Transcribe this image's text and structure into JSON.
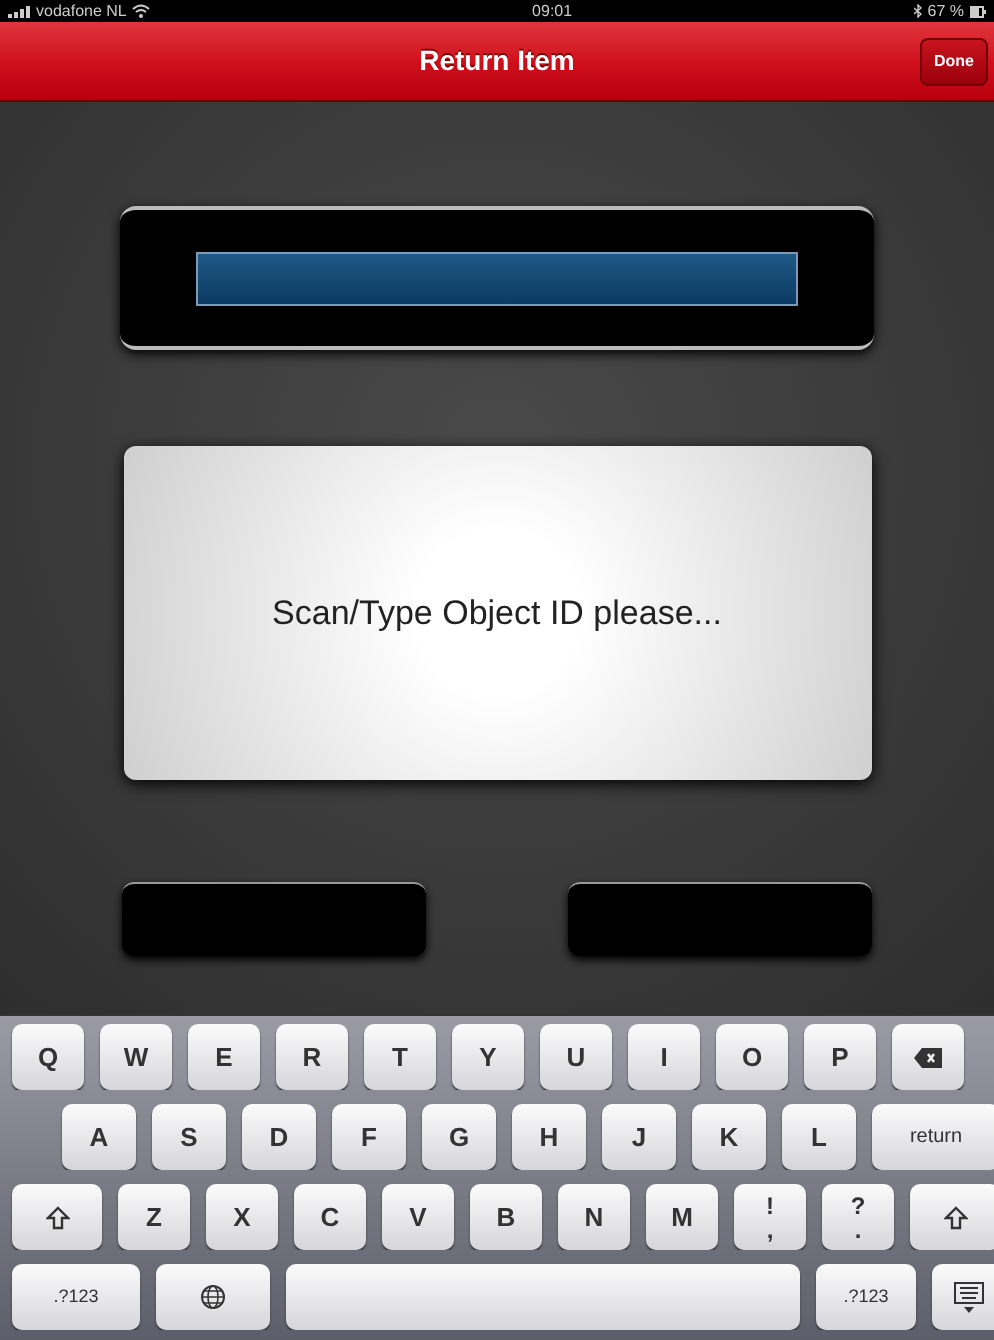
{
  "status_bar": {
    "carrier": "vodafone NL",
    "time": "09:01",
    "battery": "67 %"
  },
  "nav_bar": {
    "title": "Return Item",
    "done_button": "Done"
  },
  "message": "Scan/Type Object ID please...",
  "keyboard": {
    "rows": [
      [
        {
          "kind": "char",
          "label": "Q"
        },
        {
          "kind": "char",
          "label": "W"
        },
        {
          "kind": "char",
          "label": "E"
        },
        {
          "kind": "char",
          "label": "R"
        },
        {
          "kind": "char",
          "label": "T"
        },
        {
          "kind": "char",
          "label": "Y"
        },
        {
          "kind": "char",
          "label": "U"
        },
        {
          "kind": "char",
          "label": "I"
        },
        {
          "kind": "char",
          "label": "O"
        },
        {
          "kind": "char",
          "label": "P"
        },
        {
          "kind": "backspace"
        }
      ],
      [
        {
          "kind": "char",
          "label": "A"
        },
        {
          "kind": "char",
          "label": "S"
        },
        {
          "kind": "char",
          "label": "D"
        },
        {
          "kind": "char",
          "label": "F"
        },
        {
          "kind": "char",
          "label": "G"
        },
        {
          "kind": "char",
          "label": "H"
        },
        {
          "kind": "char",
          "label": "J"
        },
        {
          "kind": "char",
          "label": "K"
        },
        {
          "kind": "char",
          "label": "L"
        },
        {
          "kind": "return",
          "label": "return"
        }
      ],
      [
        {
          "kind": "shift"
        },
        {
          "kind": "char",
          "label": "Z"
        },
        {
          "kind": "char",
          "label": "X"
        },
        {
          "kind": "char",
          "label": "C"
        },
        {
          "kind": "char",
          "label": "V"
        },
        {
          "kind": "char",
          "label": "B"
        },
        {
          "kind": "char",
          "label": "N"
        },
        {
          "kind": "char",
          "label": "M"
        },
        {
          "kind": "dual",
          "label": "!",
          "sub": ","
        },
        {
          "kind": "dual",
          "label": "?",
          "sub": "."
        },
        {
          "kind": "shift"
        }
      ],
      [
        {
          "kind": "mode",
          "label": ".?123"
        },
        {
          "kind": "globe"
        },
        {
          "kind": "space"
        },
        {
          "kind": "mode",
          "label": ".?123"
        },
        {
          "kind": "hide"
        }
      ]
    ]
  }
}
